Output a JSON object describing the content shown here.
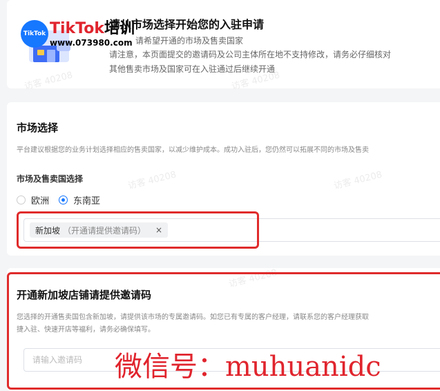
{
  "header": {
    "title": "请从市场选择开始您的入驻申请",
    "line1": "请希望开通的市场及售卖国家",
    "line2": "请注意，本页面提交的邀请码及公司主体所在地不支持修改，请务必仔细核对",
    "line3": "其他售卖市场及国家可在入驻通过后继续开通"
  },
  "logo": {
    "circle": "TikTok",
    "brand_red": "TikTok",
    "brand_black": "培训",
    "url": "www.073980.com"
  },
  "market": {
    "title": "市场选择",
    "desc": "平台建议根据您的业务计划选择相应的售卖国家，以减少维护成本。成功入驻后，您仍然可以拓展不同的市场及售卖",
    "field_label": "市场及售卖国选择",
    "options": [
      "欧洲",
      "东南亚"
    ],
    "selected": "东南亚",
    "tag_label": "新加坡",
    "tag_hint": "（开通请提供邀请码）",
    "tag_close": "×"
  },
  "invite": {
    "title": "开通新加坡店铺请提供邀请码",
    "desc1": "您选择的开通售卖国包含新加坡，请提供该市场的专属邀请码。如您已有专属的客户经理，请联系您的客户经理获取",
    "desc2": "捷入驻、快速开店等福利，请务必确保填写。",
    "placeholder": "请输入邀请码"
  },
  "overlay": {
    "wechat": "微信号：muhuanidc"
  },
  "watermark": "访客 40208",
  "colors": {
    "accent": "#1677ff",
    "highlight": "#e02b2b"
  }
}
